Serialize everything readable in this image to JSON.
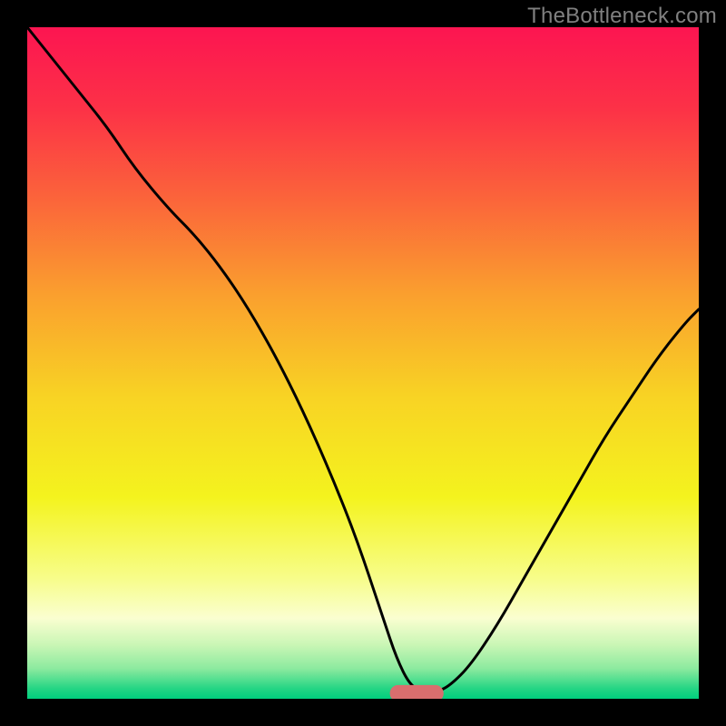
{
  "watermark": "TheBottleneck.com",
  "colors": {
    "frame": "#000000",
    "gradient_stops": [
      {
        "offset": 0.0,
        "color": "#fc1551"
      },
      {
        "offset": 0.12,
        "color": "#fc3147"
      },
      {
        "offset": 0.25,
        "color": "#fb623b"
      },
      {
        "offset": 0.4,
        "color": "#faa02e"
      },
      {
        "offset": 0.55,
        "color": "#f8d324"
      },
      {
        "offset": 0.7,
        "color": "#f4f31e"
      },
      {
        "offset": 0.82,
        "color": "#f7fd89"
      },
      {
        "offset": 0.88,
        "color": "#fafed0"
      },
      {
        "offset": 0.92,
        "color": "#c9f6b5"
      },
      {
        "offset": 0.955,
        "color": "#8cea9f"
      },
      {
        "offset": 0.985,
        "color": "#24d584"
      },
      {
        "offset": 1.0,
        "color": "#00cf7e"
      }
    ],
    "curve": "#000000",
    "pill": "#da6e6e"
  },
  "chart_data": {
    "type": "line",
    "title": "",
    "xlabel": "",
    "ylabel": "",
    "xlim": [
      0,
      100
    ],
    "ylim": [
      0,
      100
    ],
    "series": [
      {
        "name": "bottleneck-curve",
        "x": [
          0,
          4,
          8,
          12,
          16,
          21,
          25,
          29,
          33,
          37,
          41,
          45,
          49,
          53,
          55,
          57,
          59,
          61,
          63,
          66,
          70,
          74,
          78,
          82,
          86,
          90,
          94,
          98,
          100
        ],
        "y": [
          100,
          95,
          90,
          85,
          79,
          73,
          69,
          64,
          58,
          51,
          43,
          34,
          24,
          12,
          6,
          2,
          1,
          1,
          2,
          5,
          11,
          18,
          25,
          32,
          39,
          45,
          51,
          56,
          58
        ]
      }
    ],
    "annotations": [
      {
        "name": "optimal-pill",
        "x_center": 58,
        "y": 0.8,
        "width": 8,
        "height": 2.5
      }
    ]
  }
}
